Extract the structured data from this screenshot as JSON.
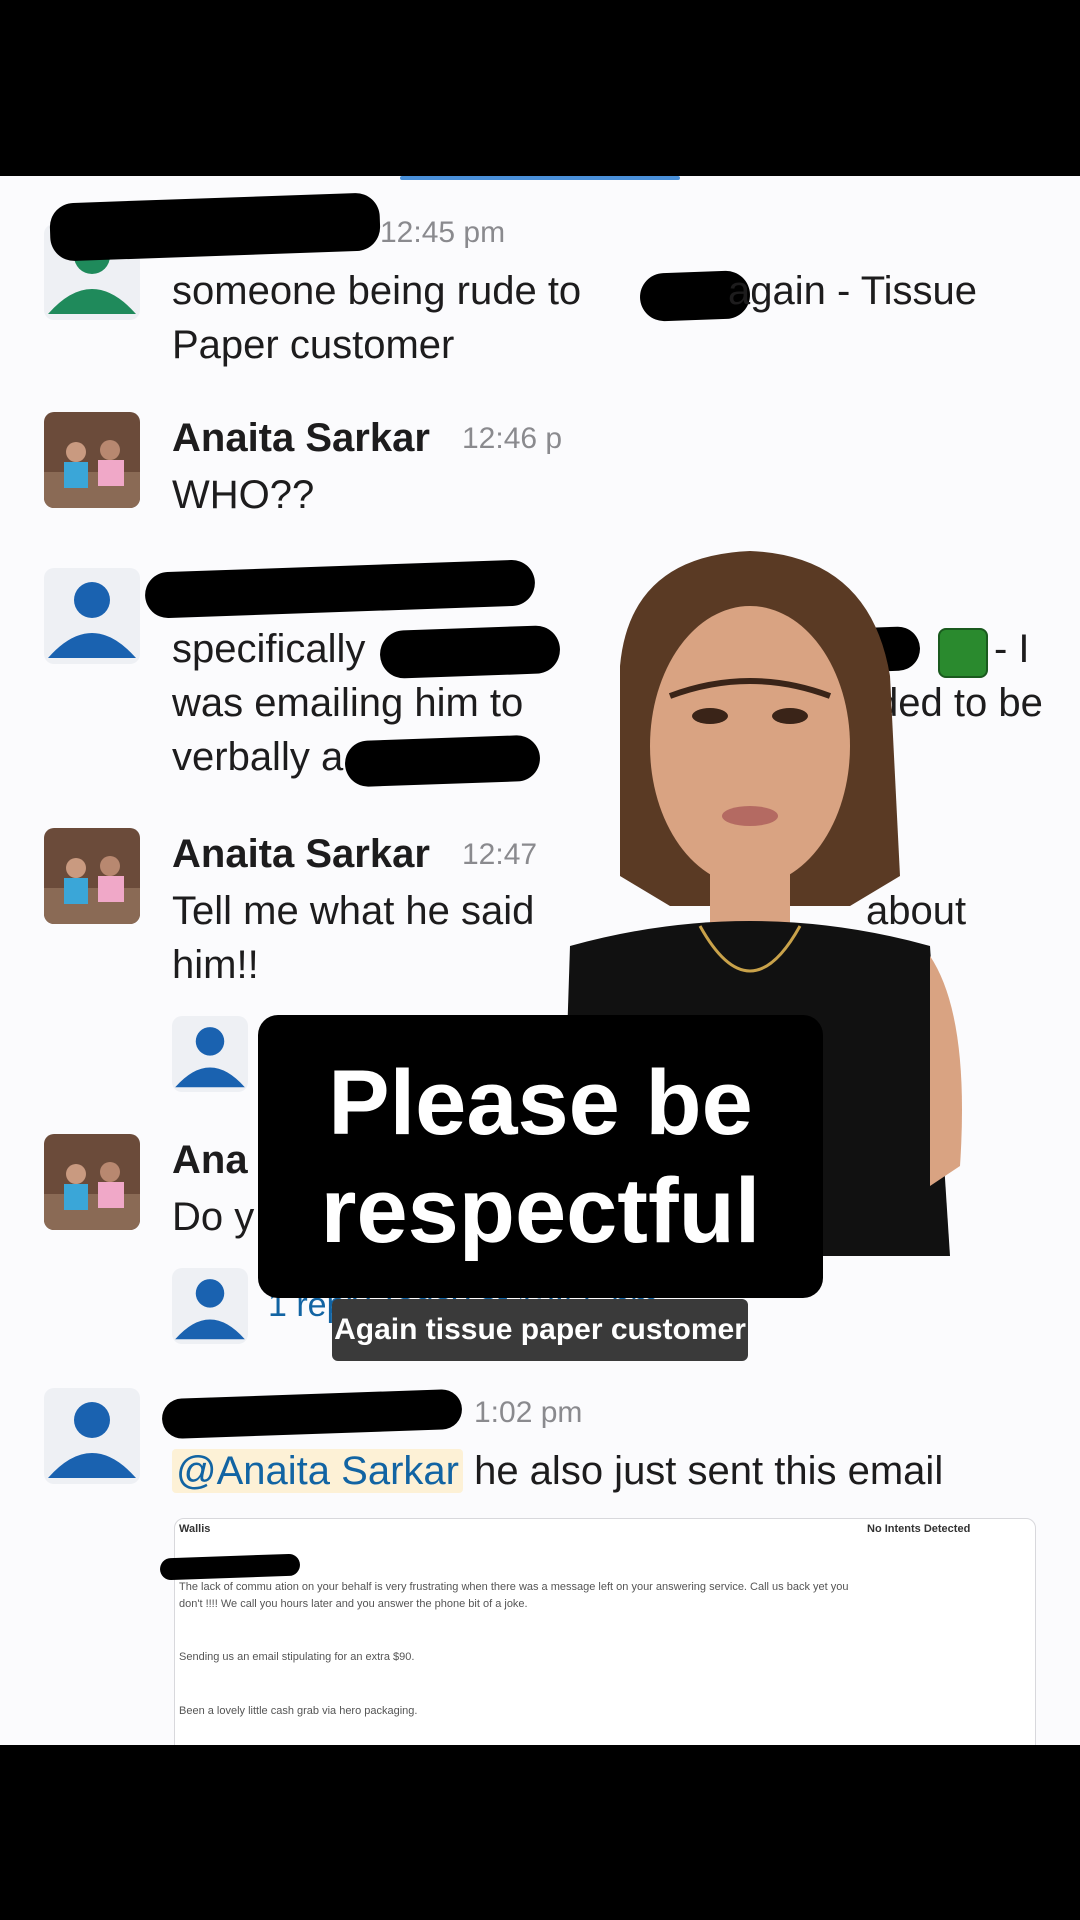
{
  "messages": [
    {
      "time": "12:45 pm",
      "lines": [
        "someone being rude to",
        "again - Tissue",
        "Paper customer"
      ]
    },
    {
      "name": "Anaita Sarkar",
      "time": "12:46 p",
      "lines": [
        "WHO??"
      ]
    },
    {
      "lines": [
        "specifically",
        "- I",
        "was emailing him to",
        "ded to be",
        "verbally a"
      ]
    },
    {
      "name": "Anaita Sarkar",
      "time": "12:47",
      "lines": [
        "Tell me what he said",
        "about",
        "him!!"
      ]
    },
    {
      "name": "Ana",
      "lines": [
        "Do y"
      ],
      "reply": "1 reply Today at 12:55 pm"
    },
    {
      "time": "1:02 pm",
      "mention": "@Anaita Sarkar",
      "text": "he also just sent this email"
    }
  ],
  "email": {
    "sender": "Wallis",
    "status": "No Intents Detected",
    "body": [
      "The lack of commu   ation on your behalf is very frustrating when there was a message left on your answering service. Call us back yet you",
      "don't !!!! We call you hours later and you answer the phone bit of a joke.",
      "Sending us an email stipulating for an extra $90.",
      "Been a lovely little cash grab via hero packaging."
    ]
  },
  "overlay": {
    "caption_line1": "Please be",
    "caption_line2": "respectful",
    "subcaption": "Again tissue paper customer"
  },
  "colors": {
    "link": "#1264a3",
    "green": "#1f8a5b",
    "default_avatar": "#1a62b0"
  }
}
